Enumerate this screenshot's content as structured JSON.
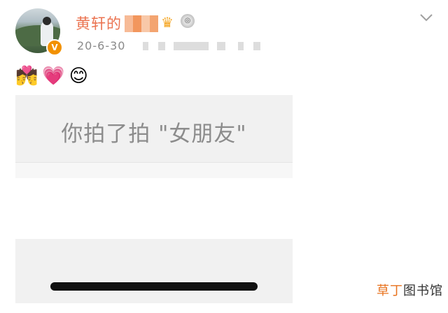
{
  "post": {
    "username": "黄轩的",
    "timestamp": "20-6-30",
    "verified_badge": "V",
    "verified_color": "#f29100",
    "username_color": "#eb7350",
    "emojis": [
      "💏",
      "💗",
      "😊"
    ],
    "icons": [
      "crown-icon",
      "medal-icon",
      "chevron-down-icon"
    ]
  },
  "pat_notice": {
    "text": "你拍了拍 \"女朋友\""
  },
  "watermark": {
    "part1": "草丁",
    "part2": "图书馆",
    "accent_color": "#e8731f"
  }
}
